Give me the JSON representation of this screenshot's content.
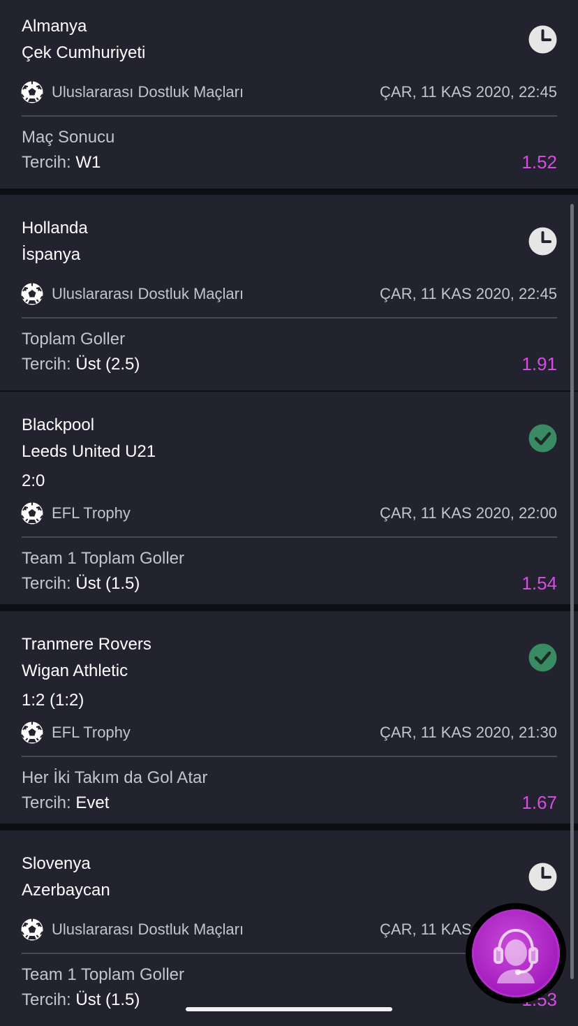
{
  "bets": [
    {
      "team1": "Almanya",
      "team2": "Çek Cumhuriyeti",
      "score": "",
      "status": "clock-icon",
      "league": "Uluslararası Dostluk Maçları",
      "datetime": "ÇAR, 11 KAS 2020, 22:45",
      "market": "Maç Sonucu",
      "pick_label": "Tercih:",
      "pick_value": "W1",
      "odds": "1.52"
    },
    {
      "team1": "Hollanda",
      "team2": "İspanya",
      "score": "",
      "status": "clock-icon",
      "league": "Uluslararası Dostluk Maçları",
      "datetime": "ÇAR, 11 KAS 2020, 22:45",
      "market": "Toplam Goller",
      "pick_label": "Tercih:",
      "pick_value": "Üst (2.5)",
      "odds": "1.91"
    },
    {
      "team1": "Blackpool",
      "team2": "Leeds United U21",
      "score": "2:0",
      "status": "check-icon",
      "league": "EFL Trophy",
      "datetime": "ÇAR, 11 KAS 2020, 22:00",
      "market": "Team 1 Toplam Goller",
      "pick_label": "Tercih:",
      "pick_value": "Üst (1.5)",
      "odds": "1.54"
    },
    {
      "team1": "Tranmere Rovers",
      "team2": "Wigan Athletic",
      "score": "1:2 (1:2)",
      "status": "check-icon",
      "league": "EFL Trophy",
      "datetime": "ÇAR, 11 KAS 2020, 21:30",
      "market": "Her İki Takım da Gol Atar",
      "pick_label": "Tercih:",
      "pick_value": "Evet",
      "odds": "1.67"
    },
    {
      "team1": "Slovenya",
      "team2": "Azerbaycan",
      "score": "",
      "status": "clock-icon",
      "league": "Uluslararası Dostluk Maçları",
      "datetime": "ÇAR, 11 KAS 2020, 22:45",
      "market": "Team 1 Toplam Goller",
      "pick_label": "Tercih:",
      "pick_value": "Üst (1.5)",
      "odds": "1.53"
    }
  ],
  "colors": {
    "background": "#0d0d14",
    "card": "#23232f",
    "odds": "#d44ee0",
    "check": "#3a8a63",
    "clock": "#e6e6e6",
    "fab": "#a31bbd"
  },
  "support_button": {
    "icon": "support-agent-icon"
  }
}
